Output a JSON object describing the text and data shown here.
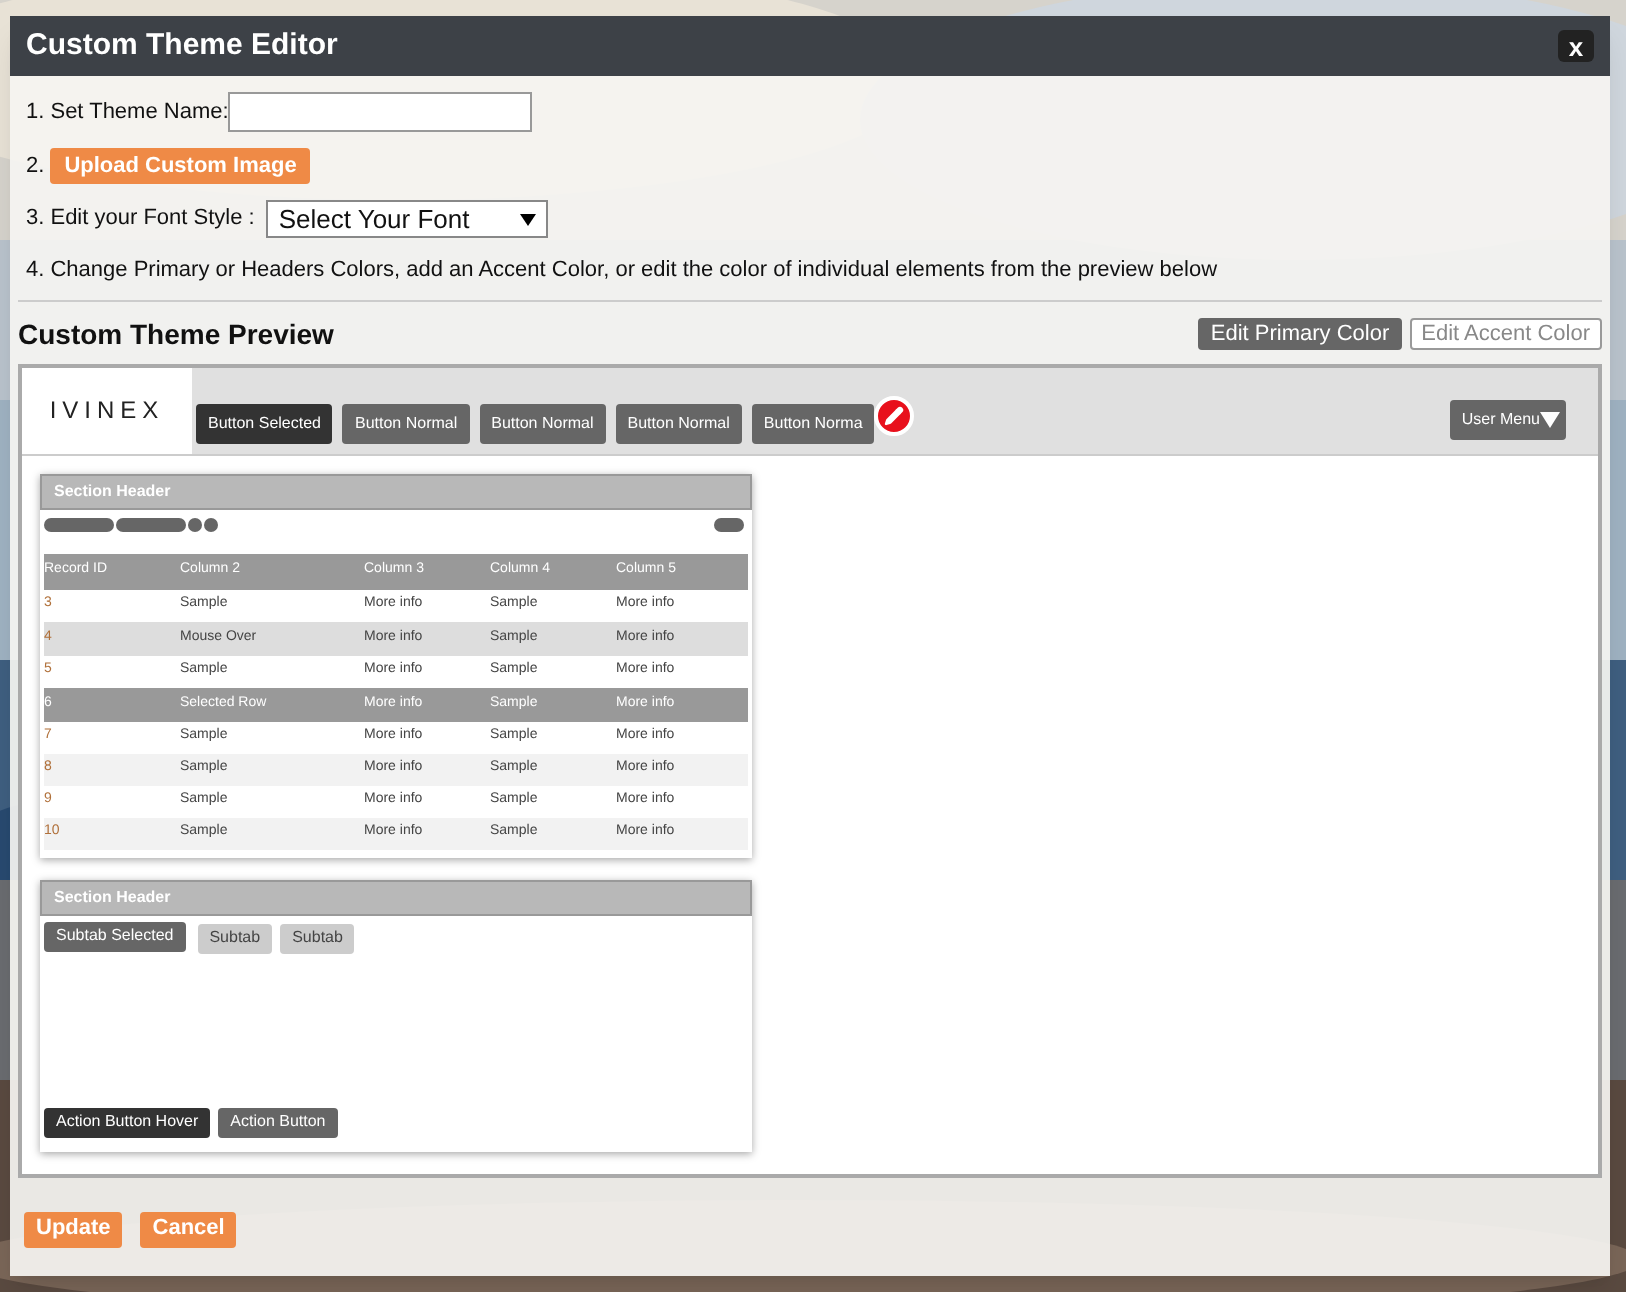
{
  "dialog": {
    "title": "Custom Theme Editor",
    "close": "x"
  },
  "steps": {
    "name_label": "1. Set Theme Name:",
    "image_prefix": "2.",
    "image_button": "Upload Custom Image",
    "font_label": "3. Edit your Font Style :",
    "font_select": "Select Your Font",
    "colors_text": "4. Change Primary or Headers Colors, add an Accent Color, or edit the color of individual elements from the preview below"
  },
  "preview": {
    "title": "Custom Theme Preview",
    "color_buttons": [
      {
        "label": "Edit Primary Color",
        "selected": true
      },
      {
        "label": "Edit Accent Color",
        "selected": false
      }
    ],
    "logo": "IVINEX",
    "nav_buttons": [
      {
        "label": "Button Selected",
        "selected": true,
        "editing": false
      },
      {
        "label": "Button Normal",
        "selected": false,
        "editing": false
      },
      {
        "label": "Button Normal",
        "selected": false,
        "editing": false
      },
      {
        "label": "Button Normal",
        "selected": false,
        "editing": false
      },
      {
        "label": "Button Norma",
        "selected": false,
        "editing": true
      }
    ],
    "user_menu": "User Menu",
    "table_section": {
      "header": "Section Header",
      "columns": [
        "Record ID",
        "Column 2",
        "Column 3",
        "Column 4",
        "Column 5"
      ],
      "rows": [
        {
          "cells": [
            "3",
            "Sample",
            "More info",
            "Sample",
            "More info"
          ],
          "hover": false,
          "selected": false
        },
        {
          "cells": [
            "4",
            "Mouse Over",
            "More info",
            "Sample",
            "More info"
          ],
          "hover": true,
          "selected": false
        },
        {
          "cells": [
            "5",
            "Sample",
            "More info",
            "Sample",
            "More info"
          ],
          "hover": false,
          "selected": false
        },
        {
          "cells": [
            "6",
            "Selected Row",
            "More info",
            "Sample",
            "More info"
          ],
          "hover": false,
          "selected": true
        },
        {
          "cells": [
            "7",
            "Sample",
            "More info",
            "Sample",
            "More info"
          ],
          "hover": false,
          "selected": false
        },
        {
          "cells": [
            "8",
            "Sample",
            "More info",
            "Sample",
            "More info"
          ],
          "hover": false,
          "selected": false
        },
        {
          "cells": [
            "9",
            "Sample",
            "More info",
            "Sample",
            "More info"
          ],
          "hover": false,
          "selected": false
        },
        {
          "cells": [
            "10",
            "Sample",
            "More info",
            "Sample",
            "More info"
          ],
          "hover": false,
          "selected": false
        }
      ]
    },
    "tabs_section": {
      "header": "Section Header",
      "subtabs": [
        {
          "label": "Subtab Selected",
          "selected": true
        },
        {
          "label": "Subtab",
          "selected": false
        },
        {
          "label": "Subtab",
          "selected": false
        }
      ],
      "action_buttons": [
        {
          "label": "Action Button Hover",
          "hover": true
        },
        {
          "label": "Action Button",
          "hover": false
        }
      ]
    }
  },
  "footer_buttons": [
    "Update",
    "Cancel"
  ]
}
